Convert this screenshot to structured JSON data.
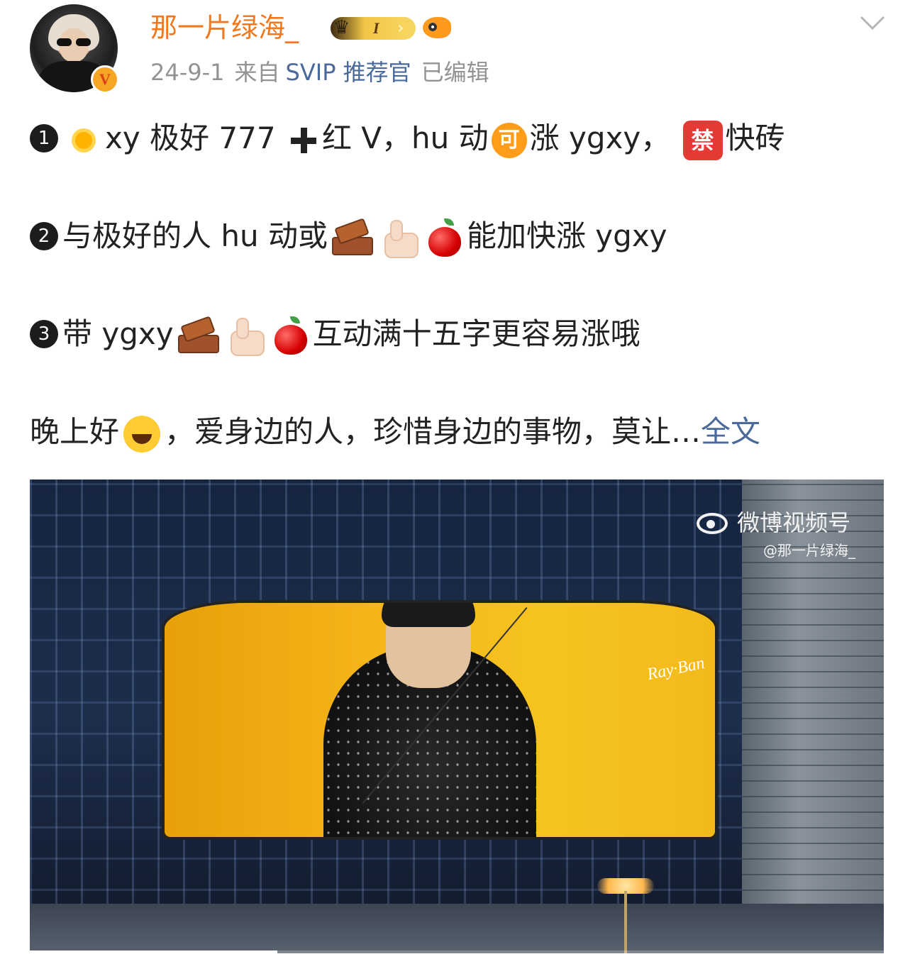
{
  "post": {
    "username": "那一片绿海_",
    "badges": {
      "level": "I",
      "verified_mark": "V"
    },
    "meta": {
      "date": "24-9-1",
      "from": "来自",
      "source": "SVIP 推荐官",
      "edited": "已编辑"
    }
  },
  "content": {
    "line1": {
      "num": "1",
      "a": "xy 极好 777",
      "b": "红 V，hu 动",
      "ke": "可",
      "c": "涨 ygxy，",
      "jin": "禁",
      "d": "快砖"
    },
    "line2": {
      "num": "2",
      "a": "与极好的人 hu 动或",
      "b": "能加快涨 ygxy"
    },
    "line3": {
      "num": "3",
      "a": "带 ygxy",
      "b": "互动满十五字更容易涨哦"
    },
    "line4": {
      "a": "晚上好",
      "b": "，爱身边的人，珍惜身边的事物，莫让…",
      "more": "全文"
    }
  },
  "video": {
    "watermark_title": "微博视频号",
    "watermark_handle": "@那一片绿海_",
    "progress": 0.29
  },
  "icons": {
    "collapse": "chevron-down-icon",
    "emoji_sun": "sun-icon",
    "emoji_plus": "plus-icon",
    "emoji_brick": "brick-icon",
    "emoji_thumb": "thumbs-up-icon",
    "emoji_apple": "apple-icon",
    "emoji_smile": "smile-icon"
  },
  "colors": {
    "username": "#f0781e",
    "link": "#4a6a9c",
    "meta": "#939393"
  }
}
